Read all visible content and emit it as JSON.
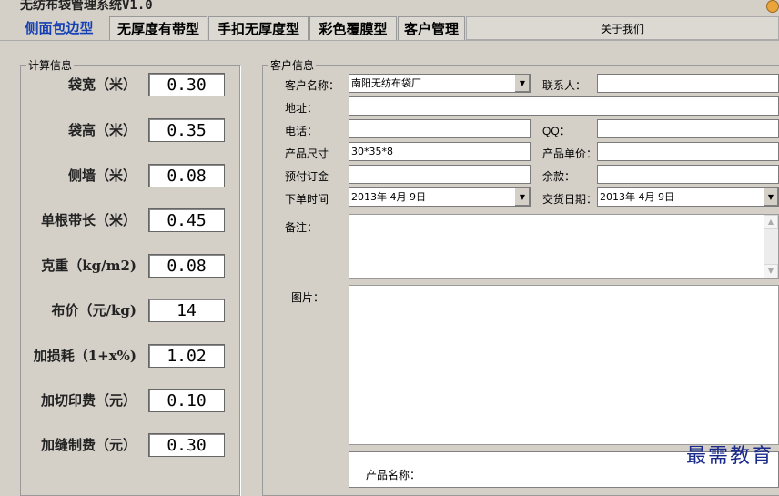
{
  "window": {
    "title": "无纺布袋管理系统V1.0"
  },
  "tabs": [
    {
      "label": "侧面包边型"
    },
    {
      "label": "无厚度有带型"
    },
    {
      "label": "手扣无厚度型"
    },
    {
      "label": "彩色覆膜型"
    },
    {
      "label": "客户管理"
    },
    {
      "label": "关于我们"
    }
  ],
  "calc": {
    "legend": "计算信息",
    "rows": [
      {
        "label": "袋宽（米）",
        "value": "0.30"
      },
      {
        "label": "袋高（米）",
        "value": "0.35"
      },
      {
        "label": "侧墙（米）",
        "value": "0.08"
      },
      {
        "label": "单根带长（米）",
        "value": "0.45"
      },
      {
        "label": "克重（kg/m2)",
        "value": "0.08"
      },
      {
        "label": "布价（元/kg)",
        "value": "14"
      },
      {
        "label": "加损耗（1+x%)",
        "value": "1.02"
      },
      {
        "label": "加切印费（元）",
        "value": "0.10"
      },
      {
        "label": "加缝制费（元）",
        "value": "0.30"
      }
    ]
  },
  "customer": {
    "legend": "客户信息",
    "name_label": "客户名称：",
    "name_value": "南阳无纺布袋厂",
    "contact_label": "联系人：",
    "contact_value": "",
    "address_label": "地址：",
    "address_value": "",
    "phone_label": "电话：",
    "phone_value": "",
    "qq_label": "QQ：",
    "qq_value": "",
    "size_label": "产品尺寸",
    "size_value": "30*35*8",
    "unit_price_label": "产品单价：",
    "unit_price_value": "",
    "deposit_label": "预付订金",
    "deposit_value": "",
    "balance_label": "余款：",
    "balance_value": "",
    "order_time_label": "下单时间",
    "order_time_value": "2013年 4月 9日",
    "delivery_label": "交货日期：",
    "delivery_value": "2013年 4月 9日",
    "remark_label": "备注：",
    "image_label": "图片：",
    "grid_header": "产品名称："
  },
  "watermark": "最需教育"
}
